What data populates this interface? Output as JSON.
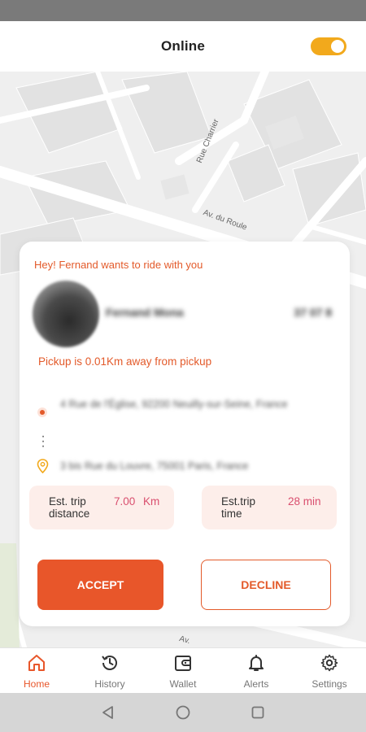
{
  "header": {
    "title": "Online",
    "online_toggle": "on"
  },
  "colors": {
    "accent": "#e8562a",
    "toggle": "#f2a91c",
    "value": "#d94e6e",
    "stat_bg": "#fdeeea"
  },
  "map": {
    "streets": [
      "Rue Charrier",
      "Av. du Roule",
      "Av."
    ]
  },
  "request": {
    "title": "Hey! Fernand wants to ride with you",
    "rider_name": "Fernand Mona",
    "rider_phone": "37 07 8",
    "pickup_note": "Pickup is 0.01Km away from pickup",
    "pickup_address": "4 Rue de l'Église, 92200 Neuilly-sur-Seine, France",
    "drop_address": "3 bis Rue du Louvre, 75001 Paris, France",
    "distance_label": "Est. trip distance",
    "distance_value": "7.00 Km",
    "time_label": "Est.trip time",
    "time_value": "28 min",
    "accept_label": "ACCEPT",
    "decline_label": "DECLINE"
  },
  "nav": {
    "items": [
      {
        "label": "Home",
        "icon": "home-icon",
        "active": true
      },
      {
        "label": "History",
        "icon": "history-icon",
        "active": false
      },
      {
        "label": "Wallet",
        "icon": "wallet-icon",
        "active": false
      },
      {
        "label": "Alerts",
        "icon": "bell-icon",
        "active": false
      },
      {
        "label": "Settings",
        "icon": "gear-icon",
        "active": false
      }
    ]
  }
}
